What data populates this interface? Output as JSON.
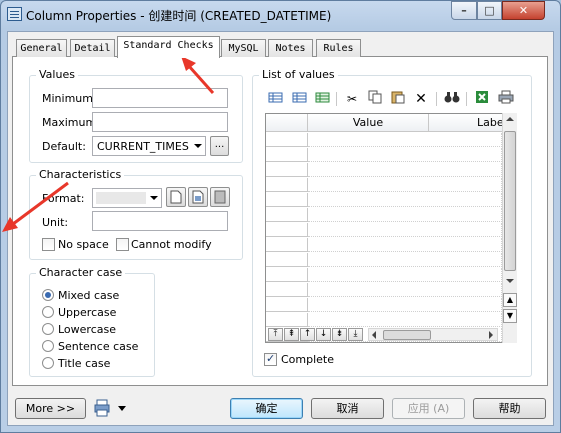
{
  "window": {
    "title": "Column Properties - 创建时间 (CREATED_DATETIME)",
    "min_glyph": "–",
    "max_glyph": "□",
    "close_glyph": "✕"
  },
  "tabs": [
    {
      "label": "General"
    },
    {
      "label": "Detail"
    },
    {
      "label": "Standard Checks",
      "active": true
    },
    {
      "label": "MySQL"
    },
    {
      "label": "Notes"
    },
    {
      "label": "Rules"
    }
  ],
  "values_group": {
    "title": "Values",
    "minimum_label": "Minimum:",
    "minimum_value": "",
    "maximum_label": "Maximum:",
    "maximum_value": "",
    "default_label": "Default:",
    "default_value": "CURRENT_TIMES",
    "ellipsis": "..."
  },
  "characteristics_group": {
    "title": "Characteristics",
    "format_label": "Format:",
    "format_value": "",
    "unit_label": "Unit:",
    "unit_value": "",
    "no_space_label": "No space",
    "cannot_modify_label": "Cannot modify"
  },
  "character_case": {
    "title": "Character case",
    "options": [
      "Mixed case",
      "Uppercase",
      "Lowercase",
      "Sentence case",
      "Title case"
    ],
    "selected": "Mixed case"
  },
  "list_of_values": {
    "title": "List of values",
    "columns": [
      "Value",
      "Label"
    ],
    "toolbar_icons": [
      "add-row-icon",
      "insert-row-icon",
      "add-rows-icon",
      "cut-icon",
      "copy-icon",
      "paste-icon",
      "delete-icon",
      "find-icon",
      "excel-icon",
      "print-icon"
    ],
    "complete_label": "Complete",
    "complete_checked": true
  },
  "footer": {
    "more_label": "More >>",
    "ok_label": "确定",
    "cancel_label": "取消",
    "apply_label": "应用 (A)",
    "help_label": "帮助"
  },
  "colors": {
    "annotation_red": "#e8372a",
    "accent": "#3c7fb1"
  }
}
